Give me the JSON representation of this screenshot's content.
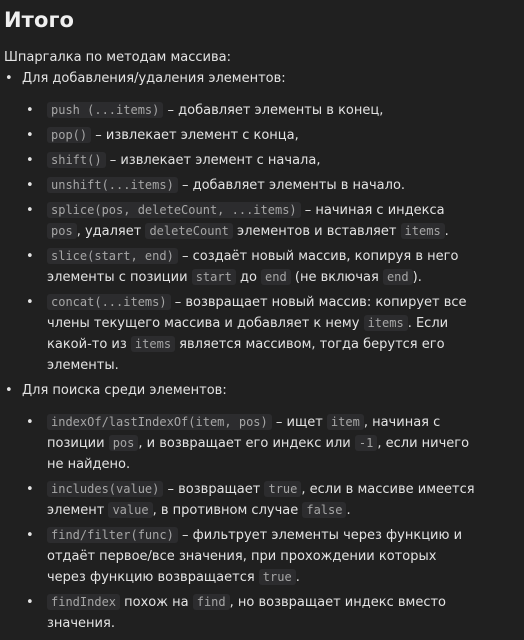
{
  "title": "Итого",
  "intro": "Шпаргалка по методам массива:",
  "sections": [
    {
      "label": "Для добавления/удаления элементов:",
      "items": [
        [
          {
            "c": "push (...items)"
          },
          {
            "t": " – добавляет элементы в конец,"
          }
        ],
        [
          {
            "c": "pop()"
          },
          {
            "t": " – извлекает элемент с конца,"
          }
        ],
        [
          {
            "c": "shift()"
          },
          {
            "t": " – извлекает элемент с начала,"
          }
        ],
        [
          {
            "c": "unshift(...items)"
          },
          {
            "t": " – добавляет элементы в начало."
          }
        ],
        [
          {
            "c": "splice(pos, deleteCount, ...items)"
          },
          {
            "t": " – начиная с индекса "
          },
          {
            "c": "pos"
          },
          {
            "t": ", удаляет "
          },
          {
            "c": "deleteCount"
          },
          {
            "t": " элементов и вставляет "
          },
          {
            "c": "items"
          },
          {
            "t": "."
          }
        ],
        [
          {
            "c": "slice(start, end)"
          },
          {
            "t": " – создаёт новый массив, копируя в него элементы с позиции "
          },
          {
            "c": "start"
          },
          {
            "t": " до "
          },
          {
            "c": "end"
          },
          {
            "t": " (не включая "
          },
          {
            "c": "end"
          },
          {
            "t": ")."
          }
        ],
        [
          {
            "c": "concat(...items)"
          },
          {
            "t": " – возвращает новый массив: копирует все члены текущего массива и добавляет к нему "
          },
          {
            "c": "items"
          },
          {
            "t": ". Если какой-то из "
          },
          {
            "c": "items"
          },
          {
            "t": " является массивом, тогда берутся его элементы."
          }
        ]
      ]
    },
    {
      "label": "Для поиска среди элементов:",
      "items": [
        [
          {
            "c": "indexOf/lastIndexOf(item, pos)"
          },
          {
            "t": " – ищет "
          },
          {
            "c": "item"
          },
          {
            "t": ", начиная с позиции "
          },
          {
            "c": "pos"
          },
          {
            "t": ", и возвращает его индекс или "
          },
          {
            "c": "-1"
          },
          {
            "t": ", если ничего не найдено."
          }
        ],
        [
          {
            "c": "includes(value)"
          },
          {
            "t": " – возвращает "
          },
          {
            "c": "true"
          },
          {
            "t": ", если в массиве имеется элемент "
          },
          {
            "c": "value"
          },
          {
            "t": ", в противном случае "
          },
          {
            "c": "false"
          },
          {
            "t": "."
          }
        ],
        [
          {
            "c": "find/filter(func)"
          },
          {
            "t": " – фильтрует элементы через функцию и отдаёт первое/все значения, при прохождении которых через функцию возвращается "
          },
          {
            "c": "true"
          },
          {
            "t": "."
          }
        ],
        [
          {
            "c": "findIndex"
          },
          {
            "t": " похож на "
          },
          {
            "c": "find"
          },
          {
            "t": ", но возвращает индекс вместо значения."
          }
        ]
      ]
    }
  ]
}
